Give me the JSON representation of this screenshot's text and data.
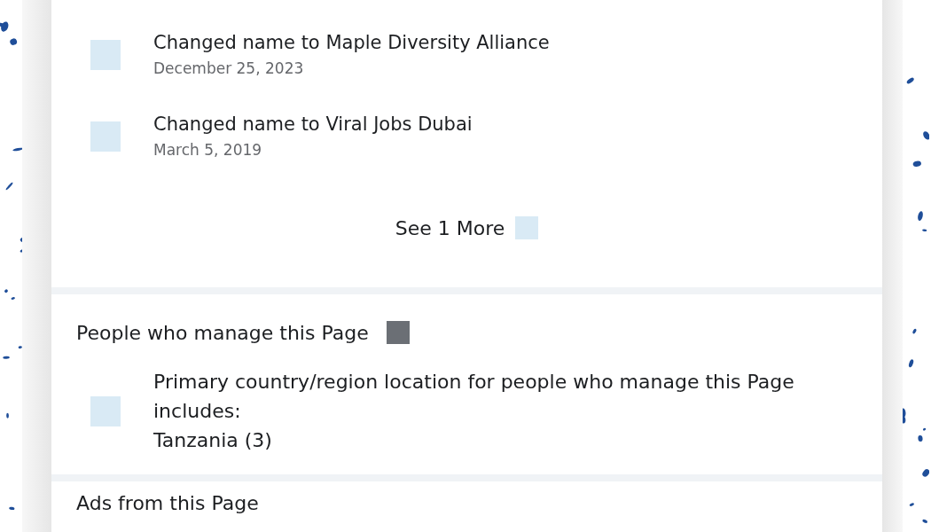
{
  "history": {
    "items": [
      {
        "title": "Changed name to Maple Diversity Alliance",
        "date": "December 25, 2023"
      },
      {
        "title": "Changed name to Viral Jobs Dubai",
        "date": "March 5, 2019"
      }
    ],
    "see_more": "See 1 More"
  },
  "managers": {
    "title": "People who manage this Page",
    "description": "Primary country/region location for people who manage this Page includes:",
    "country": "Tanzania (3)"
  },
  "ads": {
    "title": "Ads from this Page"
  }
}
